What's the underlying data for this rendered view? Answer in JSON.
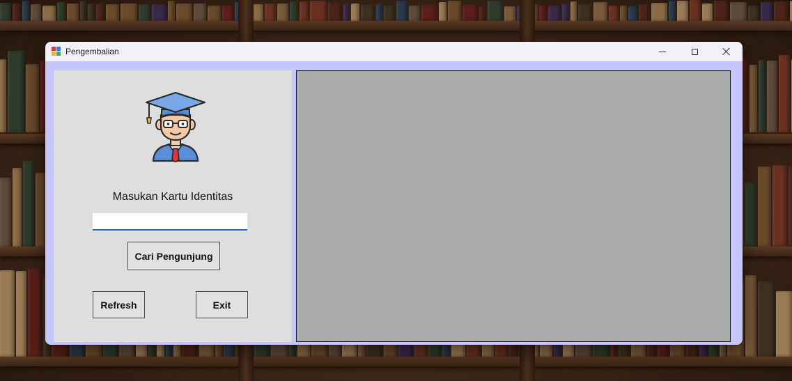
{
  "window": {
    "title": "Pengembalian",
    "app_icon": "form-app-icon",
    "controls": [
      "minimize-icon",
      "maximize-icon",
      "close-icon"
    ]
  },
  "left_panel": {
    "avatar_icon": "graduate-student-icon",
    "prompt_label": "Masukan Kartu Identitas",
    "id_input": {
      "value": "",
      "placeholder": ""
    },
    "search_button": "Cari Pengunjung",
    "refresh_button": "Refresh",
    "exit_button": "Exit"
  },
  "results_grid": {
    "rows": []
  },
  "colors": {
    "form_background": "#c7c6fc",
    "panel_background": "#dedede",
    "grid_background": "#ababab",
    "input_underline": "#1f6fbf"
  }
}
